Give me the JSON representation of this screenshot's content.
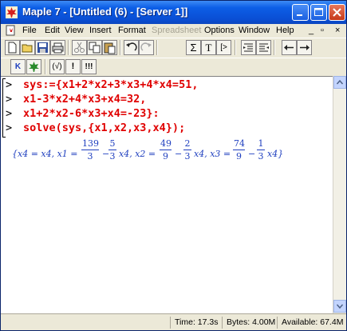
{
  "window": {
    "title": "Maple 7 - [Untitled (6) - [Server 1]]"
  },
  "menu": [
    "File",
    "Edit",
    "View",
    "Insert",
    "Format",
    "Spreadsheet",
    "Options",
    "Window",
    "Help"
  ],
  "menu_disabled": [
    "Spreadsheet"
  ],
  "toolbar1": {
    "buttons": [
      "new-icon",
      "open-icon",
      "save-icon",
      "print-icon",
      "cut-icon",
      "copy-icon",
      "paste-icon",
      "undo-icon",
      "redo-icon",
      "sigma-icon",
      "text-icon",
      "input-icon",
      "outdent-icon",
      "indent-icon",
      "back-icon",
      "forward-icon"
    ],
    "sigma": "Σ",
    "text": "T",
    "input": "[>"
  },
  "toolbar2": {
    "k": "K",
    "jump": "(√)",
    "exclaim": "!",
    "exclaim3": "!!!"
  },
  "worksheet": {
    "prompt": ">",
    "commands": [
      "sys:={x1+2*x2+3*x3+4*x4=51,",
      "x1-3*x2+4*x3+x4=32,",
      "x1+2*x2-6*x3+x4=-23}:",
      "solve(sys,{x1,x2,x3,x4});"
    ],
    "result": {
      "open": "{x4 = x4, x1 =",
      "f1_num": "139",
      "f1_den": "3",
      "minus1": "−",
      "f2_num": "5",
      "f2_den": "3",
      "mid1": "x4, x2 =",
      "f3_num": "49",
      "f3_den": "9",
      "minus2": "−",
      "f4_num": "2",
      "f4_den": "3",
      "mid2": "x4, x3 =",
      "f5_num": "74",
      "f5_den": "9",
      "minus3": "−",
      "f6_num": "1",
      "f6_den": "3",
      "close": "x4}"
    }
  },
  "status": {
    "time": "Time: 17.3s",
    "bytes": "Bytes: 4.00M",
    "available": "Available: 67.4M"
  }
}
